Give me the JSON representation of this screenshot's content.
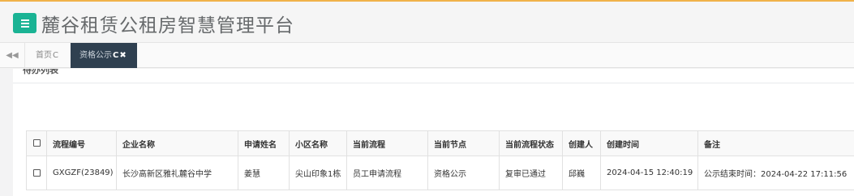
{
  "app": {
    "title": "麓谷租赁公租房智慧管理平台"
  },
  "tabs": [
    {
      "label": "首页",
      "refresh": "C"
    },
    {
      "label": "资格公示",
      "refresh": "C",
      "close": "✖"
    }
  ],
  "nav": {
    "back_glyph": "◀◀"
  },
  "panel": {
    "heading": "待办列表"
  },
  "table": {
    "headers": [
      "流程编号",
      "企业名称",
      "申请姓名",
      "小区名称",
      "当前流程",
      "当前节点",
      "当前流程状态",
      "创建人",
      "创建时间",
      "备注"
    ],
    "rows": [
      {
        "flow_no": "GXGZF(23849)",
        "company": "长沙高新区雅礼麓谷中学",
        "applicant": "姜慧",
        "community": "尖山印象1栋",
        "process": "员工申请流程",
        "node": "资格公示",
        "status": "复审已通过",
        "creator": "邱巍",
        "created": "2024-04-15 12:40:19",
        "remark": "公示结束时间：2024-04-22 17:11:56"
      }
    ]
  },
  "colors": {
    "accent": "#1ab394",
    "active_tab": "#2f4050",
    "top_border": "#f0b24a"
  },
  "icons": {
    "menu": "menu-icon",
    "back": "double-left-icon",
    "refresh": "refresh-icon",
    "close": "close-icon"
  }
}
